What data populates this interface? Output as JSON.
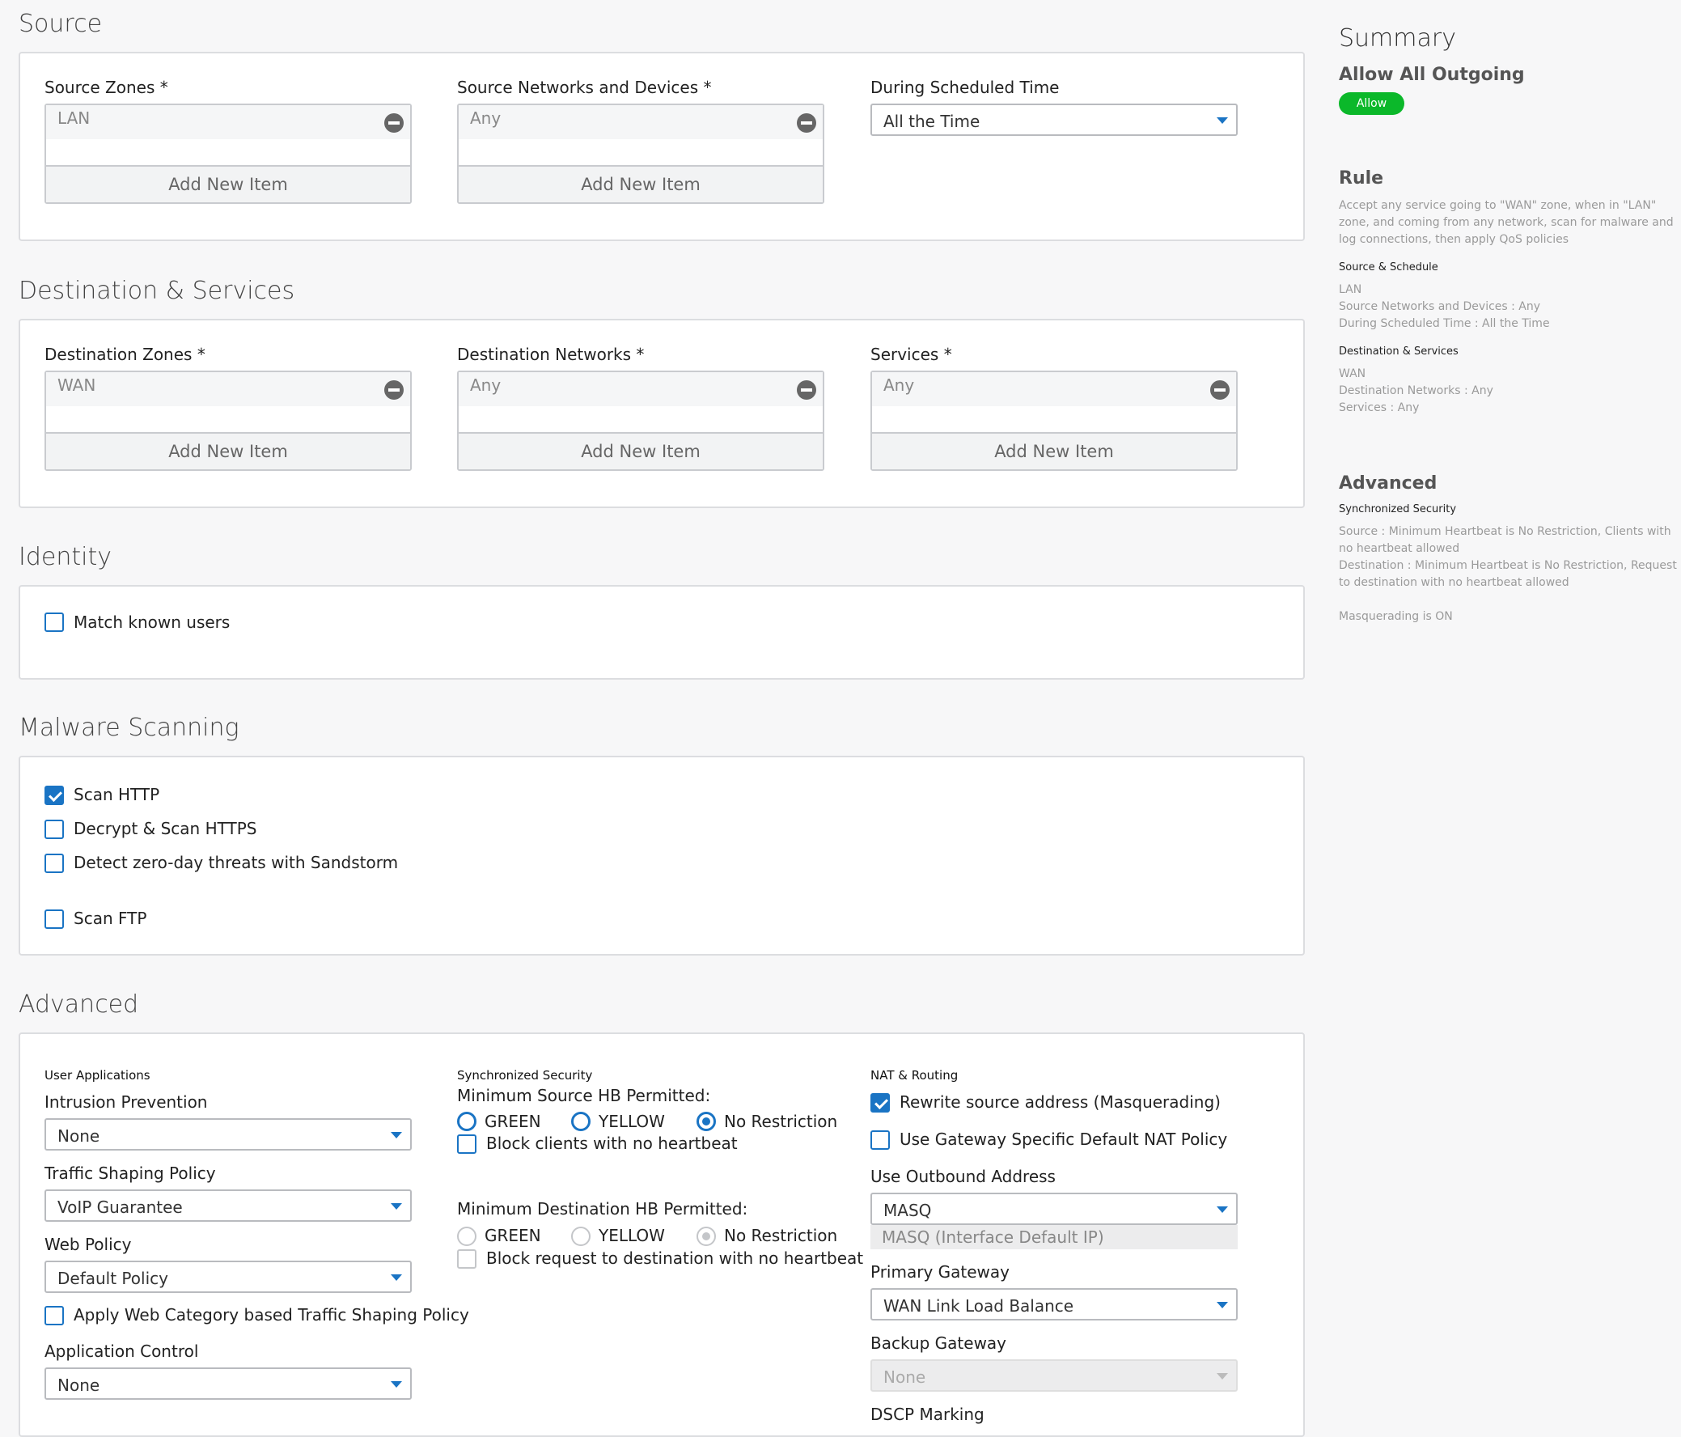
{
  "source": {
    "title": "Source",
    "zones": {
      "label": "Source Zones *",
      "item": "LAN",
      "add": "Add New Item"
    },
    "networks": {
      "label": "Source Networks and Devices *",
      "item": "Any",
      "add": "Add New Item"
    },
    "schedule": {
      "label": "During Scheduled Time",
      "value": "All the Time"
    }
  },
  "destination": {
    "title": "Destination & Services",
    "zones": {
      "label": "Destination Zones *",
      "item": "WAN",
      "add": "Add New Item"
    },
    "networks": {
      "label": "Destination Networks *",
      "item": "Any",
      "add": "Add New Item"
    },
    "services": {
      "label": "Services *",
      "item": "Any",
      "add": "Add New Item"
    }
  },
  "identity": {
    "title": "Identity",
    "match_known_users": {
      "label": "Match known users",
      "checked": false
    }
  },
  "malware": {
    "title": "Malware Scanning",
    "scan_http": {
      "label": "Scan HTTP",
      "checked": true
    },
    "decrypt_https": {
      "label": "Decrypt & Scan HTTPS",
      "checked": false
    },
    "sandstorm": {
      "label": "Detect zero-day threats with Sandstorm",
      "checked": false
    },
    "scan_ftp": {
      "label": "Scan FTP",
      "checked": false
    }
  },
  "advanced": {
    "title": "Advanced",
    "user_apps": {
      "heading": "User Applications",
      "ips_label": "Intrusion Prevention",
      "ips_value": "None",
      "shaping_label": "Traffic Shaping Policy",
      "shaping_value": "VoIP Guarantee",
      "web_label": "Web Policy",
      "web_value": "Default Policy",
      "web_cat_label": "Apply Web Category based Traffic Shaping Policy",
      "appctl_label": "Application Control",
      "appctl_value": "None"
    },
    "sync_sec": {
      "heading": "Synchronized Security",
      "min_src_label": "Minimum Source HB Permitted:",
      "green": "GREEN",
      "yellow": "YELLOW",
      "no_restriction": "No Restriction",
      "block_clients": "Block clients with no heartbeat",
      "min_dst_label": "Minimum Destination HB Permitted:",
      "block_request": "Block request to destination with no heartbeat"
    },
    "nat": {
      "heading": "NAT & Routing",
      "rewrite": "Rewrite source address (Masquerading)",
      "gateway_nat": "Use Gateway Specific Default NAT Policy",
      "outbound_label": "Use Outbound Address",
      "outbound_value": "MASQ",
      "outbound_info": "MASQ (Interface Default IP)",
      "primary_label": "Primary Gateway",
      "primary_value": "WAN Link Load Balance",
      "backup_label": "Backup Gateway",
      "backup_value": "None",
      "dscp_label": "DSCP Marking"
    }
  },
  "summary": {
    "title": "Summary",
    "rule_name": "Allow All Outgoing",
    "badge": "Allow",
    "rule_heading": "Rule",
    "rule_text": "Accept any service going to \"WAN\" zone, when in \"LAN\" zone, and coming from any network, scan for malware and log connections, then apply QoS policies",
    "src_sched_heading": "Source & Schedule",
    "src_line1": "LAN",
    "src_line2": "Source Networks and Devices : Any",
    "src_line3": "During Scheduled Time : All the Time",
    "dst_heading": "Destination & Services",
    "dst_line1": "WAN",
    "dst_line2": "Destination Networks : Any",
    "dst_line3": "Services : Any",
    "adv_heading": "Advanced",
    "sync_heading": "Synchronized Security",
    "sync_src": "Source : Minimum Heartbeat is No Restriction, Clients with no heartbeat allowed",
    "sync_dst": "Destination : Minimum Heartbeat is No Restriction, Request to destination with no heartbeat allowed",
    "masq": "Masquerading is ON"
  }
}
